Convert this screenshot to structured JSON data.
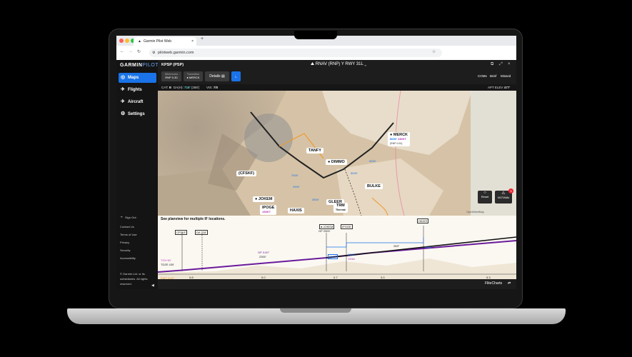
{
  "browser": {
    "tab_title": "Garmin Pilot Web",
    "new_tab": "+",
    "url": "pilotweb.garmin.com"
  },
  "sidebar": {
    "logo": "GARMIN",
    "logo_suffix": "PILOT",
    "items": [
      {
        "label": "Maps",
        "icon": "map-icon",
        "active": true
      },
      {
        "label": "Flights",
        "icon": "plane-icon"
      },
      {
        "label": "Aircraft",
        "icon": "aircraft-icon"
      },
      {
        "label": "Settings",
        "icon": "gear-icon"
      }
    ],
    "footer_links": [
      "Sign Out",
      "Contact Us",
      "Terms of Use",
      "Privacy",
      "Security",
      "Accessibility"
    ],
    "copyright": "© Garmin Ltd. or its subsidiaries. All rights reserved.",
    "collapse_glyph": "◀"
  },
  "header": {
    "airport": "KPSP (PSP)",
    "procedure": "RNAV (RNP) Y RWY 31L",
    "minimums_label": "Minimums",
    "minimums_value": "RNP 0.30",
    "transition_label": "Transition",
    "transition_value": "MERCK",
    "details_label": "Details",
    "right_buttons": [
      "COMs",
      "Brief",
      "Missed"
    ],
    "info_cat": "CAT:",
    "info_cat_value": "B",
    "info_da": "DA(H):",
    "info_da_value": "718'",
    "info_da_extra": "(288')",
    "info_vis": "VIS:",
    "info_vis_value": "7/8",
    "apt_elev_label": "APT ELEV",
    "apt_elev_value": "477'"
  },
  "map": {
    "labels": {
      "cfskf": "(CFSKF)",
      "tanfy": "TANFY",
      "dimmo": "DIMMO",
      "merck": "MERCK",
      "merck_alt": "8000'",
      "merck_spd": "230KT",
      "merck_rnp": "(RNP 0.00)",
      "bulke": "BULKE",
      "jokem": "JOKEM",
      "gleer": "GLEER",
      "haxis": "HAXIS",
      "ipoge": "IPOGE",
      "ipoge_spd": "190KT",
      "trm": "TRM",
      "trm_sub": "Thermal",
      "alt1": "2300'",
      "alt1_sub": "0.7",
      "alt2": "3500'",
      "alt3": "5.0",
      "alt4": "2900'",
      "alt5": "3500'",
      "alt6": "5000'",
      "alt7": "2300'",
      "alt8": "6000'",
      "credit": "OpenStreetMap"
    },
    "reset_label": "Reset",
    "notams_label": "NOTAMs",
    "notams_count": "3"
  },
  "profile": {
    "note": "See planview for multiple IF locations.",
    "fixes": [
      "CFSKF",
      "DA 718'",
      "JOKEM",
      "GP 2300'",
      "IPOGE",
      "HAXIS"
    ],
    "gp_label": "GP 3.00°",
    "gp_sub": "2300'",
    "tch": "TCH 50'",
    "tdze": "TDZE 430'",
    "papi": "PAPI 3.00°",
    "papi_tch": "TCH 50'",
    "alt_2300": "2300'",
    "alt_2500": "2500'",
    "alt_190": "190kt",
    "alt_3500": "3500'",
    "course": "283°",
    "dist": [
      "0.8",
      "5.0",
      "0.7",
      "3.0",
      "5.3"
    ],
    "nm": [
      "0.0",
      "0.8",
      "5.8",
      "6.5",
      "9.6"
    ],
    "flitecharts": "FliteCharts"
  },
  "colors": {
    "accent": "#1a73e8",
    "magenta": "#b236b5",
    "orange": "#f09a2a"
  }
}
